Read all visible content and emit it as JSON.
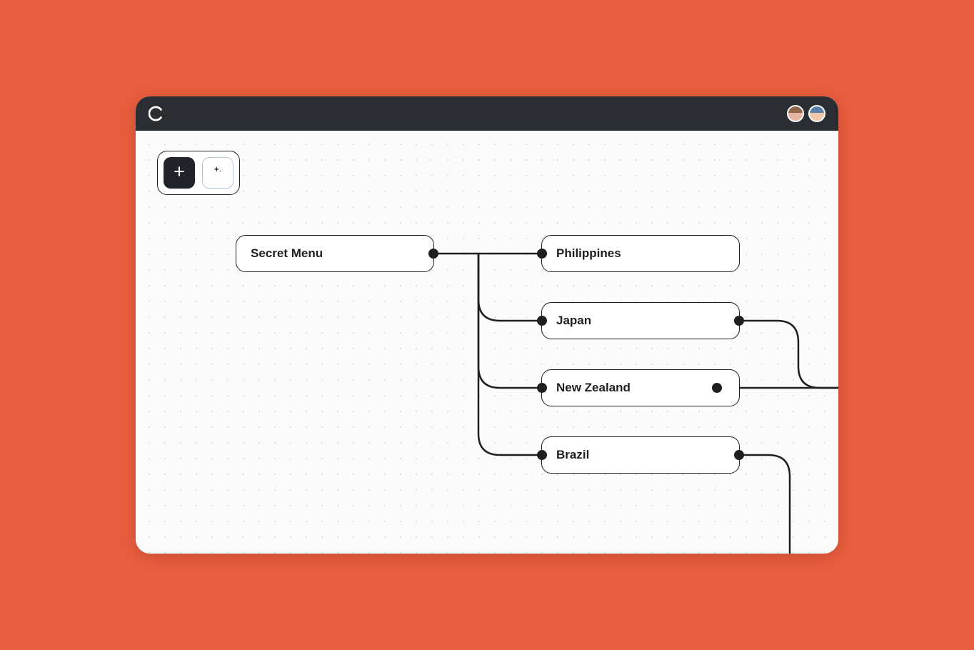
{
  "window": {
    "titlebar": {
      "logo_name": "app-logo"
    },
    "avatars": [
      "user-1",
      "user-2"
    ]
  },
  "toolbar": {
    "add_label": "Add",
    "ai_label": "AI"
  },
  "nodes": {
    "root": {
      "label": "Secret Menu"
    },
    "n1": {
      "label": "Philippines"
    },
    "n2": {
      "label": "Japan"
    },
    "n3": {
      "label": "New Zealand"
    },
    "n4": {
      "label": "Brazil"
    }
  }
}
